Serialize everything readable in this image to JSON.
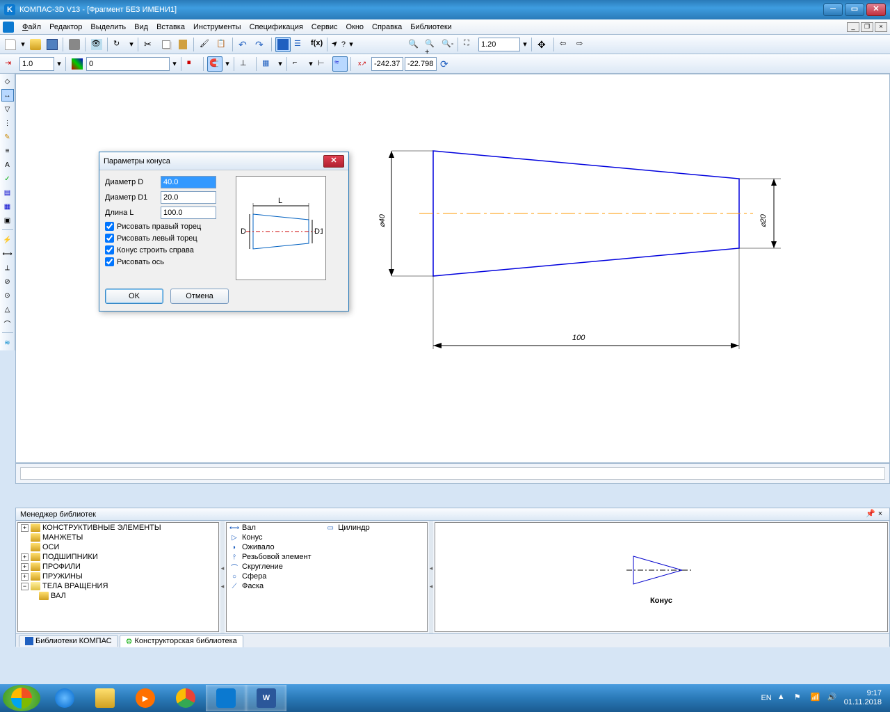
{
  "titlebar": {
    "title": "КОМПАС-3D V13 - [Фрагмент БЕЗ ИМЕНИ1]"
  },
  "menu": {
    "file": "Файл",
    "editor": "Редактор",
    "select": "Выделить",
    "view": "Вид",
    "insert": "Вставка",
    "tools": "Инструменты",
    "spec": "Спецификация",
    "service": "Сервис",
    "window": "Окно",
    "help": "Справка",
    "libs": "Библиотеки"
  },
  "tool1": {
    "scale": "1.0",
    "layer": "0"
  },
  "tool2": {
    "zoom": "1.20",
    "x": "-242.37",
    "y": "-22.798"
  },
  "dialog": {
    "title": "Параметры конуса",
    "lbl_D": "Диаметр D",
    "val_D": "40.0",
    "lbl_D1": "Диаметр D1",
    "val_D1": "20.0",
    "lbl_L": "Длина L",
    "val_L": "100.0",
    "chk1": "Рисовать правый торец",
    "chk2": "Рисовать левый торец",
    "chk3": "Конус строить справа",
    "chk4": "Рисовать ось",
    "ok": "OK",
    "cancel": "Отмена",
    "prev_D": "D",
    "prev_D1": "D1",
    "prev_L": "L"
  },
  "drawing": {
    "d40": "⌀40",
    "d20": "⌀20",
    "len": "100"
  },
  "libmgr": {
    "title": "Менеджер библиотек",
    "tree": [
      {
        "label": "КОНСТРУКТИВНЫЕ ЭЛЕМЕНТЫ",
        "exp": "+"
      },
      {
        "label": "МАНЖЕТЫ",
        "exp": ""
      },
      {
        "label": "ОСИ",
        "exp": ""
      },
      {
        "label": "ПОДШИПНИКИ",
        "exp": "+"
      },
      {
        "label": "ПРОФИЛИ",
        "exp": "+"
      },
      {
        "label": "ПРУЖИНЫ",
        "exp": "+"
      },
      {
        "label": "ТЕЛА ВРАЩЕНИЯ",
        "exp": "−",
        "child": "ВАЛ"
      }
    ],
    "list1": [
      "Вал",
      "Конус",
      "Оживало",
      "Резьбовой элемент",
      "Скругление",
      "Сфера",
      "Фаска"
    ],
    "list2": [
      "Цилиндр"
    ],
    "preview_label": "Конус",
    "tab1": "Библиотеки КОМПАС",
    "tab2": "Конструкторская библиотека"
  },
  "tray": {
    "lang": "EN",
    "time": "9:17",
    "date": "01.11.2018"
  }
}
